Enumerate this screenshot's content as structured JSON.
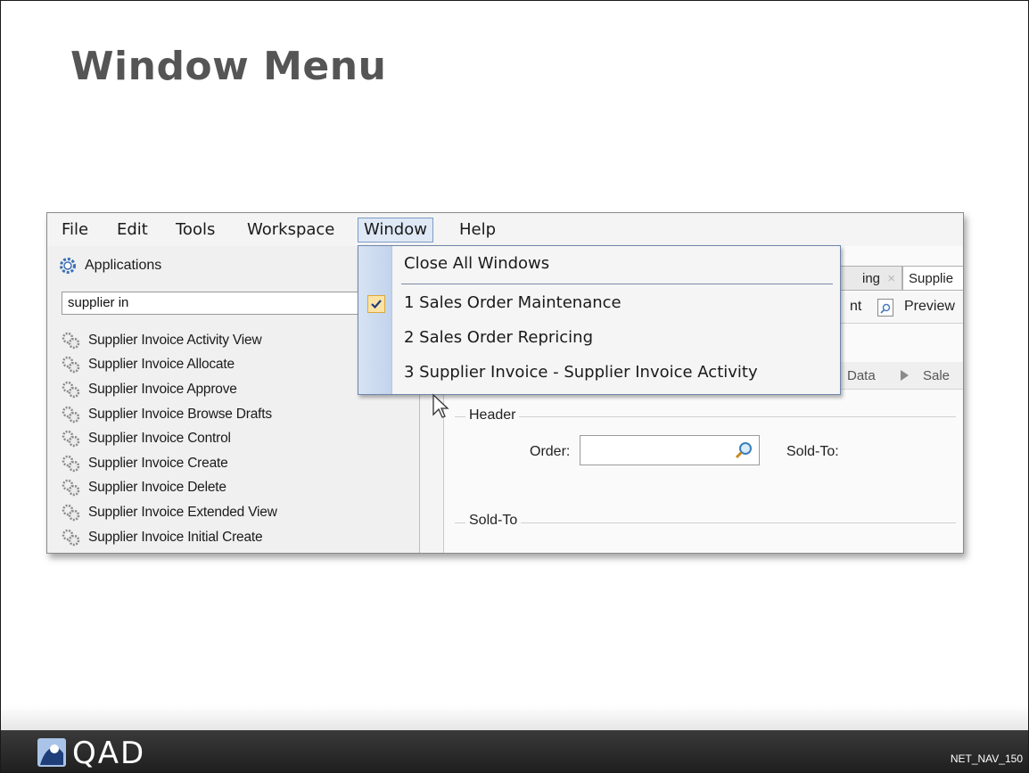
{
  "slide": {
    "title": "Window Menu",
    "footer_code": "NET_NAV_150",
    "logo_text": "QAD",
    "logo_icon": "qad-logo-icon"
  },
  "menubar": {
    "items": [
      {
        "label": "File"
      },
      {
        "label": "Edit"
      },
      {
        "label": "Tools"
      },
      {
        "label": "Workspace"
      },
      {
        "label": "Window"
      },
      {
        "label": "Help"
      }
    ],
    "active": "Window"
  },
  "window_menu": {
    "close_all": "Close All Windows",
    "windows": [
      {
        "label": "1 Sales Order Maintenance",
        "checked": true
      },
      {
        "label": "2 Sales Order Repricing",
        "checked": false
      },
      {
        "label": "3 Supplier Invoice - Supplier Invoice Activity",
        "checked": false
      }
    ]
  },
  "applications_panel": {
    "header": "Applications",
    "search_value": "supplier in",
    "items": [
      "Supplier Invoice Activity View",
      "Supplier Invoice Allocate",
      "Supplier Invoice Approve",
      "Supplier Invoice Browse Drafts",
      "Supplier Invoice Control",
      "Supplier Invoice Create",
      "Supplier Invoice Delete",
      "Supplier Invoice Extended View",
      "Supplier Invoice Initial Create"
    ]
  },
  "workspace": {
    "tabs": [
      "ing",
      "Supplie"
    ],
    "toolbar": {
      "partial_left": "nt",
      "preview": "Preview"
    },
    "breadcrumbs": [
      "Data",
      "Sale"
    ],
    "header_group": "Header",
    "order_label": "Order:",
    "order_value": "",
    "sold_to_label": "Sold-To:",
    "sold_to_group": "Sold-To"
  },
  "colors": {
    "accent_blue": "#7d9bc8",
    "menu_gutter": "#c2d3ec",
    "check_bg": "#fbe3a6",
    "title_gray": "#555555",
    "footer_dark": "#2a2a2a"
  }
}
